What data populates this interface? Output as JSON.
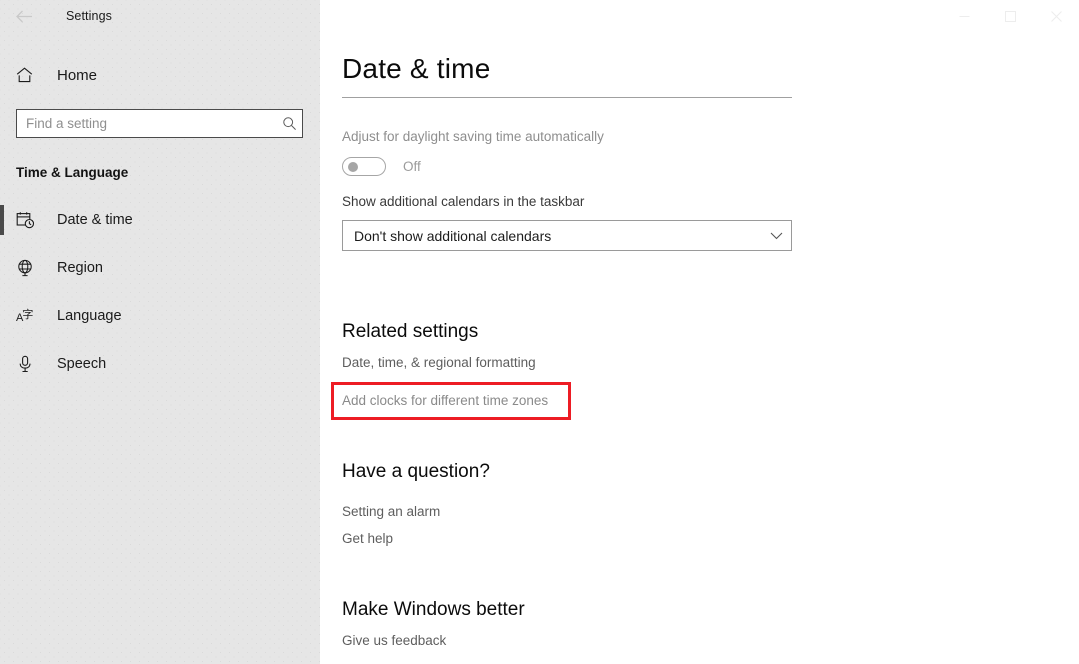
{
  "window": {
    "title": "Settings",
    "back_icon": "back-arrow-icon",
    "controls": [
      {
        "name": "minimize-button",
        "icon": "minimize-icon"
      },
      {
        "name": "maximize-button",
        "icon": "maximize-icon"
      },
      {
        "name": "close-button",
        "icon": "close-icon"
      }
    ]
  },
  "sidebar": {
    "home": {
      "label": "Home",
      "icon": "home-icon"
    },
    "search": {
      "placeholder": "Find a setting",
      "value": "",
      "icon": "search-icon"
    },
    "category": "Time & Language",
    "items": [
      {
        "label": "Date & time",
        "icon": "calendar-clock-icon",
        "selected": true
      },
      {
        "label": "Region",
        "icon": "globe-icon",
        "selected": false
      },
      {
        "label": "Language",
        "icon": "language-icon",
        "selected": false
      },
      {
        "label": "Speech",
        "icon": "microphone-icon",
        "selected": false
      }
    ]
  },
  "main": {
    "title": "Date & time",
    "daylight_saving": {
      "label": "Adjust for daylight saving time automatically",
      "state": "Off",
      "enabled": false
    },
    "additional_calendars": {
      "label": "Show additional calendars in the taskbar",
      "selected": "Don't show additional calendars",
      "chevron": "chevron-down-icon"
    },
    "related_settings": {
      "heading": "Related settings",
      "links": [
        "Date, time, & regional formatting",
        "Add clocks for different time zones"
      ]
    },
    "have_a_question": {
      "heading": "Have a question?",
      "links": [
        "Setting an alarm",
        "Get help"
      ]
    },
    "make_windows_better": {
      "heading": "Make Windows better",
      "links": [
        "Give us feedback"
      ]
    }
  },
  "annotation": {
    "highlight_color": "#ed1c24",
    "target": "Add clocks for different time zones"
  }
}
